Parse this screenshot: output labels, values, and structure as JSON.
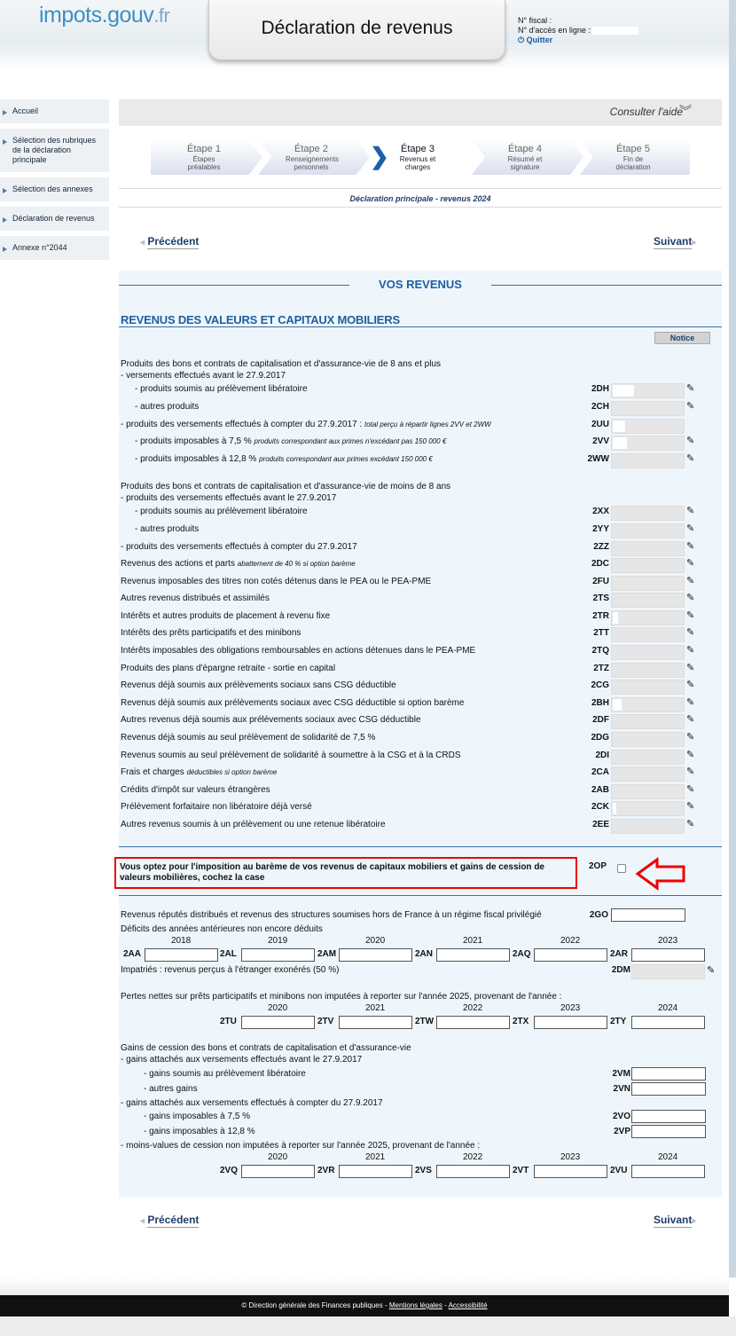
{
  "header": {
    "logo_main": "impots",
    "logo_dot": ".gouv",
    "logo_fr": ".fr",
    "title": "Déclaration de revenus",
    "fiscal_label": "N° fiscal :",
    "access_label": "N° d'accès en ligne :",
    "quit": "Quitter"
  },
  "sidebar": {
    "items": [
      "Accueil",
      "Sélection des rubriques de la déclaration principale",
      "Sélection des annexes",
      "Déclaration de revenus",
      "Annexe n°2044"
    ]
  },
  "help": {
    "label": "Consulter l'aide"
  },
  "steps": [
    {
      "title": "Étape 1",
      "sub": "Étapes préalables"
    },
    {
      "title": "Étape 2",
      "sub": "Renseignements personnels"
    },
    {
      "title": "Étape 3",
      "sub": "Revenus et charges"
    },
    {
      "title": "Étape 4",
      "sub": "Résumé et signature"
    },
    {
      "title": "Étape 5",
      "sub": "Fin de déclaration"
    }
  ],
  "current_step": 3,
  "decl_title": "Déclaration principale - revenus 2024",
  "nav": {
    "prev": "Précédent",
    "next": "Suivant"
  },
  "section_title": "VOS REVENUS",
  "subsection_title": "REVENUS DES VALEURS ET CAPITAUX MOBILIERS",
  "notice": "Notice",
  "group1_title": "Produits des bons et contrats de capitalisation et d'assurance-vie de 8 ans et plus",
  "group1_sub": "- versements effectués avant le 27.9.2017",
  "group2_title": "Produits des bons et contrats de capitalisation et d'assurance-vie de moins de 8 ans",
  "group2_sub": "- produits des versements effectués avant le 27.9.2017",
  "rows": [
    {
      "label": "- produits soumis au prélèvement libératoire",
      "note": "",
      "code": "2DH",
      "indent": true
    },
    {
      "label": "- autres produits",
      "note": "",
      "code": "2CH",
      "indent": true
    },
    {
      "label": "- produits des versements effectués à compter du 27.9.2017 :",
      "note": "total perçu à répartir lignes 2VV et 2WW",
      "code": "2UU",
      "indent": false
    },
    {
      "label": "- produits imposables à 7,5 %",
      "note": "produits correspondant aux primes n'excédant pas 150 000 €",
      "code": "2VV",
      "indent": true
    },
    {
      "label": "- produits imposables à 12,8 %",
      "note": "produits correspondant aux primes excédant 150 000 €",
      "code": "2WW",
      "indent": true
    },
    {
      "label": "- produits soumis au prélèvement libératoire",
      "note": "",
      "code": "2XX",
      "indent": true
    },
    {
      "label": "- autres produits",
      "note": "",
      "code": "2YY",
      "indent": true
    },
    {
      "label": "- produits des versements effectués à compter du 27.9.2017",
      "note": "",
      "code": "2ZZ",
      "indent": false
    },
    {
      "label": "Revenus des actions et parts",
      "note": "abattement de 40 % si option barème",
      "code": "2DC",
      "indent": false
    },
    {
      "label": "Revenus imposables des titres non cotés détenus dans le PEA ou le PEA-PME",
      "note": "",
      "code": "2FU",
      "indent": false
    },
    {
      "label": "Autres revenus distribués et assimilés",
      "note": "",
      "code": "2TS",
      "indent": false
    },
    {
      "label": "Intérêts et autres produits de placement à revenu fixe",
      "note": "",
      "code": "2TR",
      "indent": false
    },
    {
      "label": "Intérêts des prêts participatifs et des minibons",
      "note": "",
      "code": "2TT",
      "indent": false
    },
    {
      "label": "Intérêts imposables des obligations remboursables en actions détenues dans le PEA-PME",
      "note": "",
      "code": "2TQ",
      "indent": false
    },
    {
      "label": "Produits des plans d'épargne retraite - sortie en capital",
      "note": "",
      "code": "2TZ",
      "indent": false
    },
    {
      "label": "Revenus déjà soumis aux prélèvements sociaux sans CSG déductible",
      "note": "",
      "code": "2CG",
      "indent": false
    },
    {
      "label": "Revenus déjà soumis aux prélèvements sociaux avec CSG déductible si option barème",
      "note": "",
      "code": "2BH",
      "indent": false
    },
    {
      "label": "Autres revenus déjà soumis aux prélèvements sociaux avec CSG déductible",
      "note": "",
      "code": "2DF",
      "indent": false
    },
    {
      "label": "Revenus déjà soumis au seul prélèvement de solidarité de 7,5 %",
      "note": "",
      "code": "2DG",
      "indent": false
    },
    {
      "label": "Revenus soumis au seul prélèvement de solidarité à soumettre à la CSG et à la CRDS",
      "note": "",
      "code": "2DI",
      "indent": false
    },
    {
      "label": "Frais et charges",
      "note": "déductibles si option barème",
      "code": "2CA",
      "indent": false
    },
    {
      "label": "Crédits d'impôt sur valeurs étrangères",
      "note": "",
      "code": "2AB",
      "indent": false
    },
    {
      "label": "Prélèvement forfaitaire non libératoire déjà versé",
      "note": "",
      "code": "2CK",
      "indent": false
    },
    {
      "label": "Autres revenus soumis à un prélèvement ou une retenue libératoire",
      "note": "",
      "code": "2EE",
      "indent": false
    }
  ],
  "option_text": "Vous optez pour l'imposition au barème de vos revenus de capitaux mobiliers et gains de cession de valeurs mobilières, cochez la case",
  "option_code": "2OP",
  "go_label": "Revenus réputés distribués et revenus des structures soumises hors de France à un régime fiscal privilégié",
  "go_code": "2GO",
  "deficits_label": "Déficits des années antérieures non encore déduits",
  "deficits": {
    "years": [
      "2018",
      "2019",
      "2020",
      "2021",
      "2022",
      "2023"
    ],
    "codes": [
      "2AA",
      "2AL",
      "2AM",
      "2AN",
      "2AQ",
      "2AR"
    ]
  },
  "dm_label": "Impatriés : revenus perçus à l'étranger exonérés (50 %)",
  "dm_code": "2DM",
  "pertes_label": "Pertes nettes sur prêts participatifs et minibons non imputées à reporter sur l'année 2025, provenant de l'année :",
  "pertes": {
    "years": [
      "2020",
      "2021",
      "2022",
      "2023",
      "2024"
    ],
    "codes": [
      "2TU",
      "2TV",
      "2TW",
      "2TX",
      "2TY"
    ]
  },
  "gains_title": "Gains de cession des bons et contrats de capitalisation et d'assurance-vie",
  "gains_sub1": "- gains attachés aux versements effectués avant le 27.9.2017",
  "gains_rows1": [
    {
      "label": "- gains soumis au prélèvement libératoire",
      "code": "2VM"
    },
    {
      "label": "- autres gains",
      "code": "2VN"
    }
  ],
  "gains_sub2": "- gains attachés aux versements effectués à compter du 27.9.2017",
  "gains_rows2": [
    {
      "label": "- gains imposables à 7,5 %",
      "code": "2VO"
    },
    {
      "label": "- gains imposables à 12,8 %",
      "code": "2VP"
    }
  ],
  "moins_label": "- moins-values de cession non imputées à reporter sur l'année 2025, provenant de l'année :",
  "moins": {
    "years": [
      "2020",
      "2021",
      "2022",
      "2023",
      "2024"
    ],
    "codes": [
      "2VQ",
      "2VR",
      "2VS",
      "2VT",
      "2VU"
    ]
  },
  "footer": {
    "text": "© Direction générale des Finances publiques - ",
    "link1": "Mentions légales",
    "sep": " - ",
    "link2": "Accessibilité"
  }
}
